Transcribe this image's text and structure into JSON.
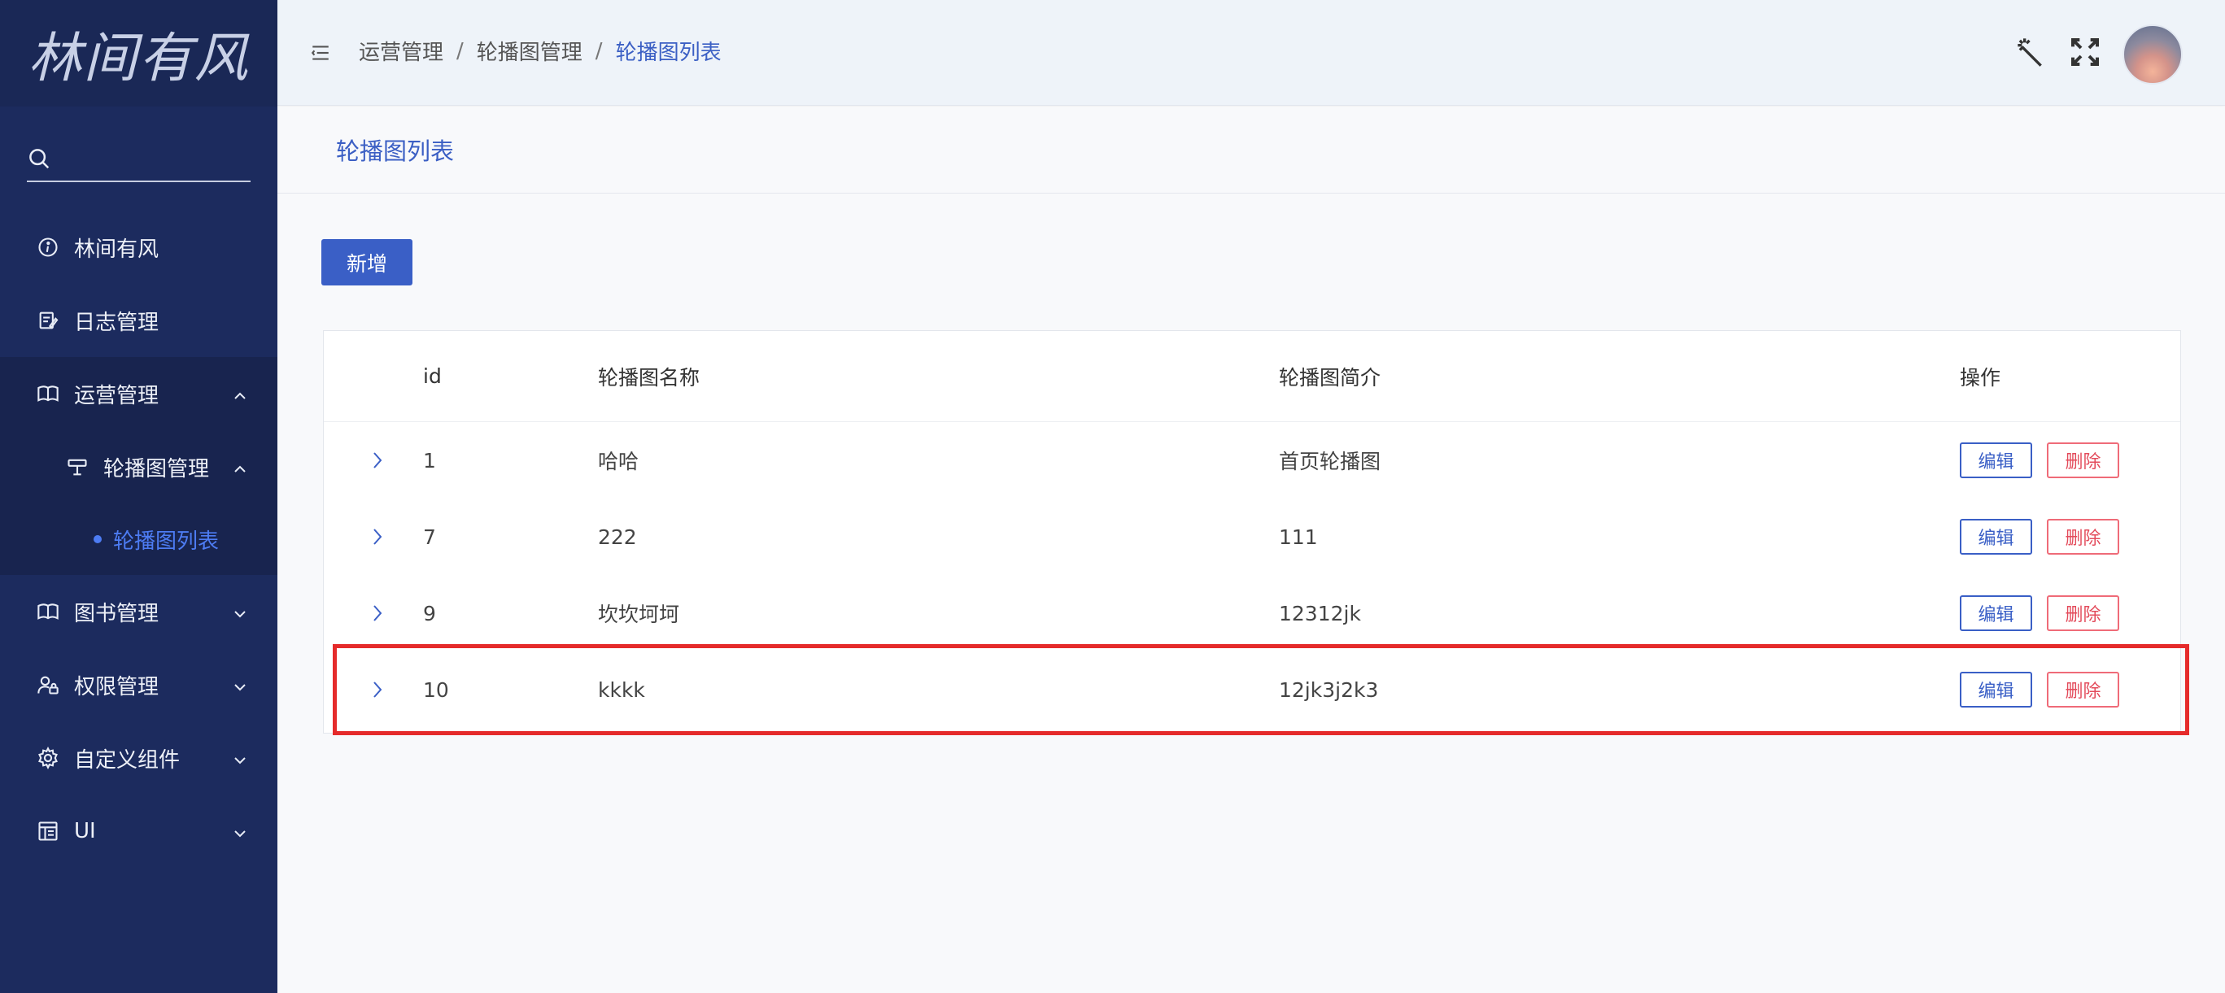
{
  "sidebar": {
    "logo_text": "林间有风",
    "search": {
      "value": "",
      "placeholder": ""
    },
    "items": [
      {
        "label": "林间有风",
        "icon": "info-icon"
      },
      {
        "label": "日志管理",
        "icon": "edit-note-icon"
      },
      {
        "label": "运营管理",
        "icon": "book-open-icon",
        "expanded": true
      },
      {
        "label": "轮播图管理",
        "icon": "carousel-icon",
        "expanded": true
      },
      {
        "label": "轮播图列表",
        "active": true
      },
      {
        "label": "图书管理",
        "icon": "book-open-icon"
      },
      {
        "label": "权限管理",
        "icon": "user-lock-icon"
      },
      {
        "label": "自定义组件",
        "icon": "gear-icon"
      },
      {
        "label": "UI",
        "icon": "layout-icon"
      }
    ]
  },
  "header": {
    "breadcrumb": [
      "运营管理",
      "轮播图管理",
      "轮播图列表"
    ],
    "separator": "/"
  },
  "page": {
    "title": "轮播图列表",
    "add_button": "新增"
  },
  "table": {
    "columns": [
      "id",
      "轮播图名称",
      "轮播图简介",
      "操作"
    ],
    "rows": [
      {
        "id": "1",
        "name": "哈哈",
        "intro": "首页轮播图"
      },
      {
        "id": "7",
        "name": "222",
        "intro": "111"
      },
      {
        "id": "9",
        "name": "坎坎坷坷",
        "intro": "12312jk"
      },
      {
        "id": "10",
        "name": "kkkk",
        "intro": "12jk3j2k3"
      }
    ],
    "edit_label": "编辑",
    "delete_label": "删除",
    "highlighted_row_index": 3
  },
  "colors": {
    "sidebar_bg": "#1c2b5e",
    "accent": "#3a5fc6",
    "danger": "#e34b5b",
    "highlight": "#e52b2b"
  }
}
